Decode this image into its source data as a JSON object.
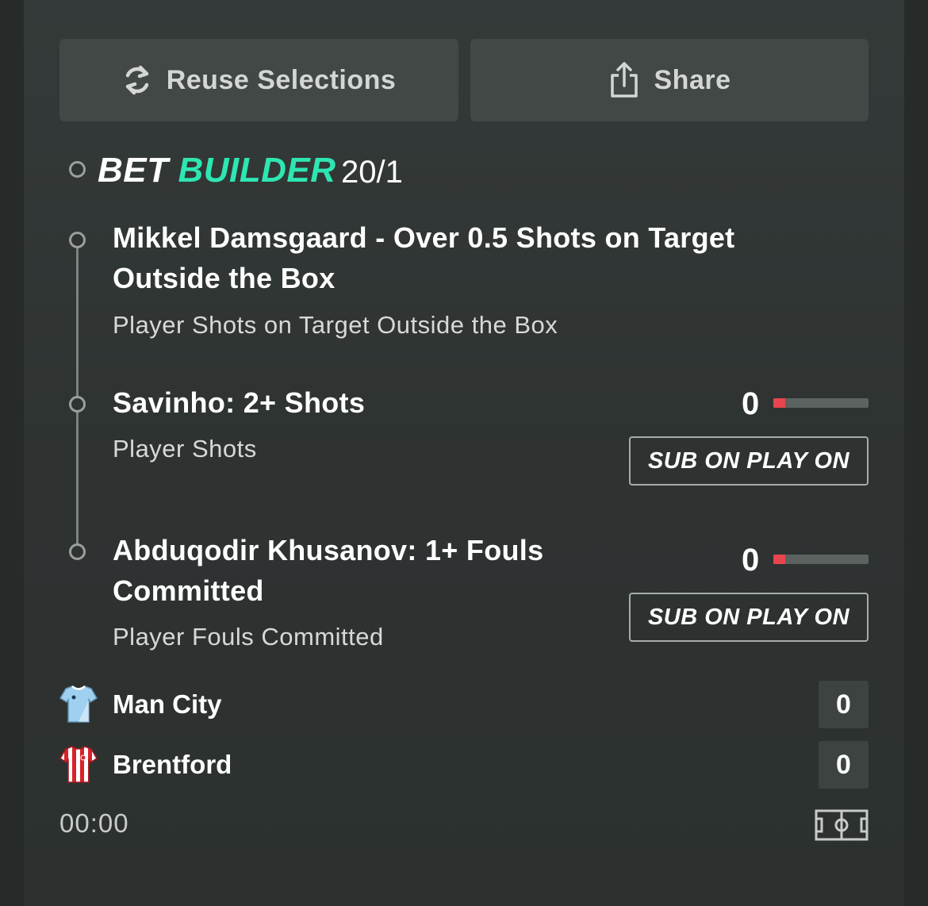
{
  "actions": {
    "reuse_label": "Reuse Selections",
    "share_label": "Share"
  },
  "bet_builder": {
    "word1": "BET",
    "word2": "BUILDER",
    "odds": "20/1"
  },
  "selections": [
    {
      "title_line1": "Mikkel Damsgaard - Over 0.5 Shots on Target",
      "title_line2": "Outside the Box",
      "market": "Player Shots on Target Outside the Box"
    },
    {
      "title_line1": "Savinho: 2+ Shots",
      "market": "Player Shots",
      "progress_value": "0",
      "progress_fraction": 0.0,
      "sub_label": "SUB ON PLAY ON"
    },
    {
      "title_line1": "Abduqodir Khusanov: 1+ Fouls",
      "title_line2": "Committed",
      "market": "Player Fouls Committed",
      "progress_value": "0",
      "progress_fraction": 0.0,
      "sub_label": "SUB ON PLAY ON"
    }
  ],
  "match": {
    "home": {
      "name": "Man City",
      "score": "0"
    },
    "away": {
      "name": "Brentford",
      "score": "0"
    },
    "clock": "00:00"
  },
  "colors": {
    "accent": "#2ee6b1",
    "progress": "#e8454f"
  },
  "icons": {
    "reuse": "refresh-icon",
    "share": "share-icon",
    "pitch": "pitch-icon"
  }
}
